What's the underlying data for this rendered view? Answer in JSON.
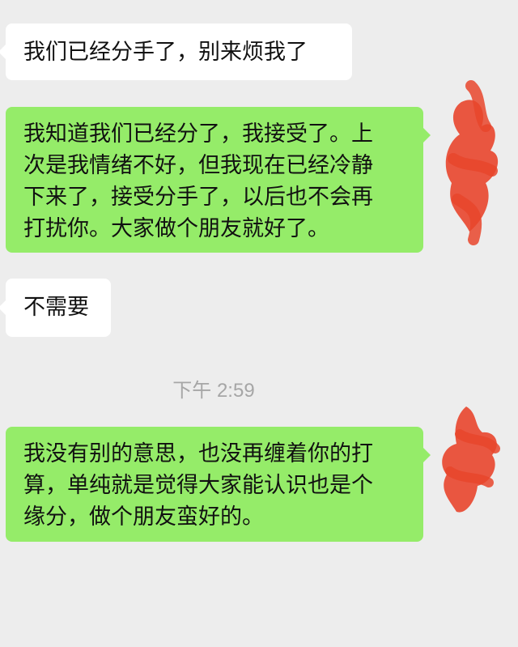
{
  "messages": [
    {
      "side": "received",
      "text": "我们已经分手了，别来烦我了"
    },
    {
      "side": "sent",
      "text": "我知道我们已经分了，我接受了。上\n次是我情绪不好，但我现在已经冷静\n下来了，接受分手了，以后也不会再\n打扰你。大家做个朋友就好了。"
    },
    {
      "side": "received",
      "text": "不需要"
    },
    {
      "side": "sent",
      "text": "我没有别的意思，也没再缠着你的打\n算，单纯就是觉得大家能认识也是个\n缘分，做个朋友蛮好的。"
    }
  ],
  "timestamp": "下午 2:59",
  "colors": {
    "background": "#ededed",
    "sent_bubble": "#95ec69",
    "received_bubble": "#ffffff",
    "timestamp_text": "#a6a6a6",
    "avatar_redaction": "#e8452c"
  },
  "avatars": [
    {
      "icon": "redacted-avatar-scribble"
    },
    {
      "icon": "redacted-avatar-scribble"
    }
  ]
}
